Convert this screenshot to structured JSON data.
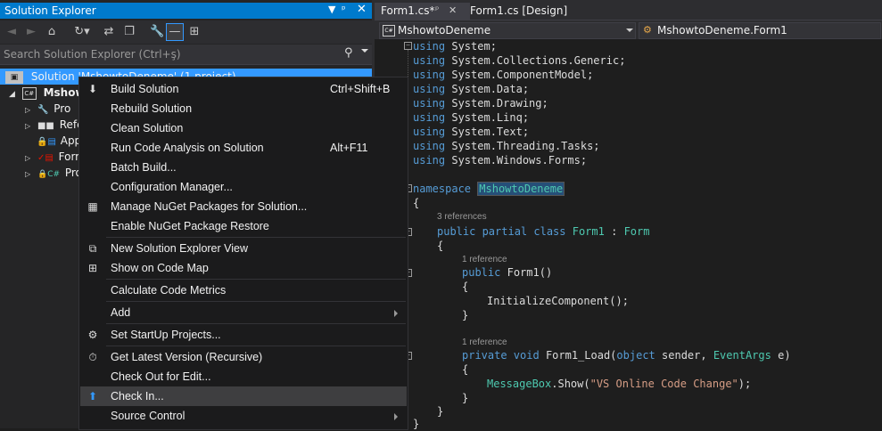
{
  "solution_explorer": {
    "title": "Solution Explorer",
    "search_placeholder": "Search Solution Explorer (Ctrl+ş)",
    "tree": [
      {
        "label": "Solution 'MshowtoDeneme' (1 project)"
      },
      {
        "label": "Mshow"
      },
      {
        "label": "Pro"
      },
      {
        "label": "Refe"
      },
      {
        "label": "App"
      },
      {
        "label": "Forr"
      },
      {
        "label": "Pro"
      }
    ]
  },
  "editor": {
    "tabs": [
      {
        "label": "Form1.cs*"
      },
      {
        "label": "Form1.cs [Design]"
      }
    ],
    "nav_left": "MshowtoDeneme",
    "nav_right": "MshowtoDeneme.Form1",
    "code": {
      "usings": [
        "System;",
        "System.Collections.Generic;",
        "System.ComponentModel;",
        "System.Data;",
        "System.Drawing;",
        "System.Linq;",
        "System.Text;",
        "System.Threading.Tasks;",
        "System.Windows.Forms;"
      ],
      "using_kw": "using",
      "namespace_kw": "namespace",
      "namespace_name": "MshowtoDeneme",
      "open_brace": "{",
      "close_brace": "}",
      "refs_class": "3 references",
      "class_line": {
        "mods": "public partial class",
        "name": "Form1",
        "colon": ":",
        "base": "Form"
      },
      "refs_ctor": "1 reference",
      "ctor_line": {
        "mod": "public",
        "name": "Form1()"
      },
      "init_call": "InitializeComponent();",
      "refs_load": "1 reference",
      "load_line": {
        "mods": "private void",
        "name": "Form1_Load(",
        "p1type": "object",
        "p1": "sender,",
        "p2type": "EventArgs",
        "p2": "e)"
      },
      "msg_line": {
        "cls": "MessageBox",
        "method": ".Show(",
        "str": "\"VS Online Code Change\"",
        "end": ");"
      }
    }
  },
  "context_menu": {
    "items": [
      {
        "label": "Build Solution",
        "shortcut": "Ctrl+Shift+B",
        "icon": "build-icon"
      },
      {
        "label": "Rebuild Solution",
        "shortcut": "",
        "icon": ""
      },
      {
        "label": "Clean Solution",
        "shortcut": "",
        "icon": ""
      },
      {
        "label": "Run Code Analysis on Solution",
        "shortcut": "Alt+F11",
        "icon": ""
      },
      {
        "label": "Batch Build...",
        "shortcut": "",
        "icon": ""
      },
      {
        "label": "Configuration Manager...",
        "shortcut": "",
        "icon": ""
      },
      {
        "label": "Manage NuGet Packages for Solution...",
        "shortcut": "",
        "icon": "nuget-icon"
      },
      {
        "label": "Enable NuGet Package Restore",
        "shortcut": "",
        "icon": ""
      },
      {
        "label": "New Solution Explorer View",
        "shortcut": "",
        "icon": "new-view-icon"
      },
      {
        "label": "Show on Code Map",
        "shortcut": "",
        "icon": "code-map-icon"
      },
      {
        "label": "Calculate Code Metrics",
        "shortcut": "",
        "icon": ""
      },
      {
        "label": "Add",
        "shortcut": "",
        "icon": ""
      },
      {
        "label": "Set StartUp Projects...",
        "shortcut": "",
        "icon": "gear-icon"
      },
      {
        "label": "Get Latest Version (Recursive)",
        "shortcut": "",
        "icon": "get-latest-icon"
      },
      {
        "label": "Check Out for Edit...",
        "shortcut": "",
        "icon": ""
      },
      {
        "label": "Check In...",
        "shortcut": "",
        "icon": "check-in-icon"
      },
      {
        "label": "Source Control",
        "shortcut": "",
        "icon": ""
      }
    ]
  },
  "colors": {
    "accent": "#007acc",
    "selection": "#3399ff",
    "keyword": "#569cd6",
    "type": "#4ec9b0",
    "string": "#d69d85"
  }
}
